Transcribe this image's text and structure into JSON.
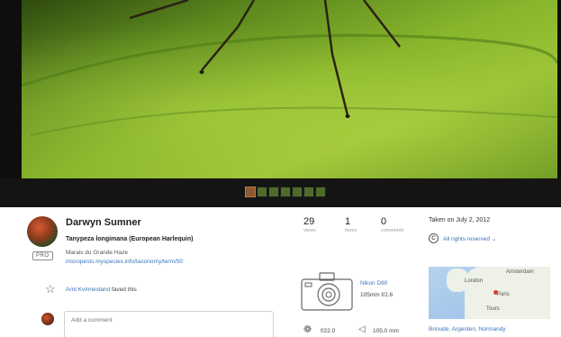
{
  "photo": {
    "thumbnail_count": 7,
    "active_thumbnail": 0
  },
  "owner": {
    "name": "Darwyn Sumner",
    "badge": "PRO"
  },
  "details": {
    "title": "Tanypeza longimana (European Harlequin)",
    "location": "Marais du Grande Haze",
    "taxonomy_link": "micropests.myspecies.info/taxonomy/term/50"
  },
  "faves": {
    "user": "Arnt Kvinnesland",
    "text": "faved this"
  },
  "comment": {
    "placeholder": "Add a comment"
  },
  "stats": [
    {
      "value": "29",
      "label": "views"
    },
    {
      "value": "1",
      "label": "faves"
    },
    {
      "value": "0",
      "label": "comments"
    }
  ],
  "exif": {
    "camera": "Nikon D80",
    "lens": "105mm f/2.8",
    "aperture": "f/22.0",
    "focal_length": "105.0 mm"
  },
  "meta": {
    "taken": "Taken on July 2, 2012",
    "license": "All rights reserved",
    "license_chevron": "⌄"
  },
  "map": {
    "labels": [
      "Amsterdam",
      "London",
      "Paris",
      "Tours"
    ],
    "place": "Brioude, Argenten, Normandy"
  },
  "icons": {
    "star": "star-icon",
    "license": "copyright-icon",
    "camera": "camera-icon",
    "aperture": "aperture-icon",
    "focal": "focal-length-icon"
  },
  "colors": {
    "link": "#3b74b8",
    "frame": "#0e0f0d"
  }
}
